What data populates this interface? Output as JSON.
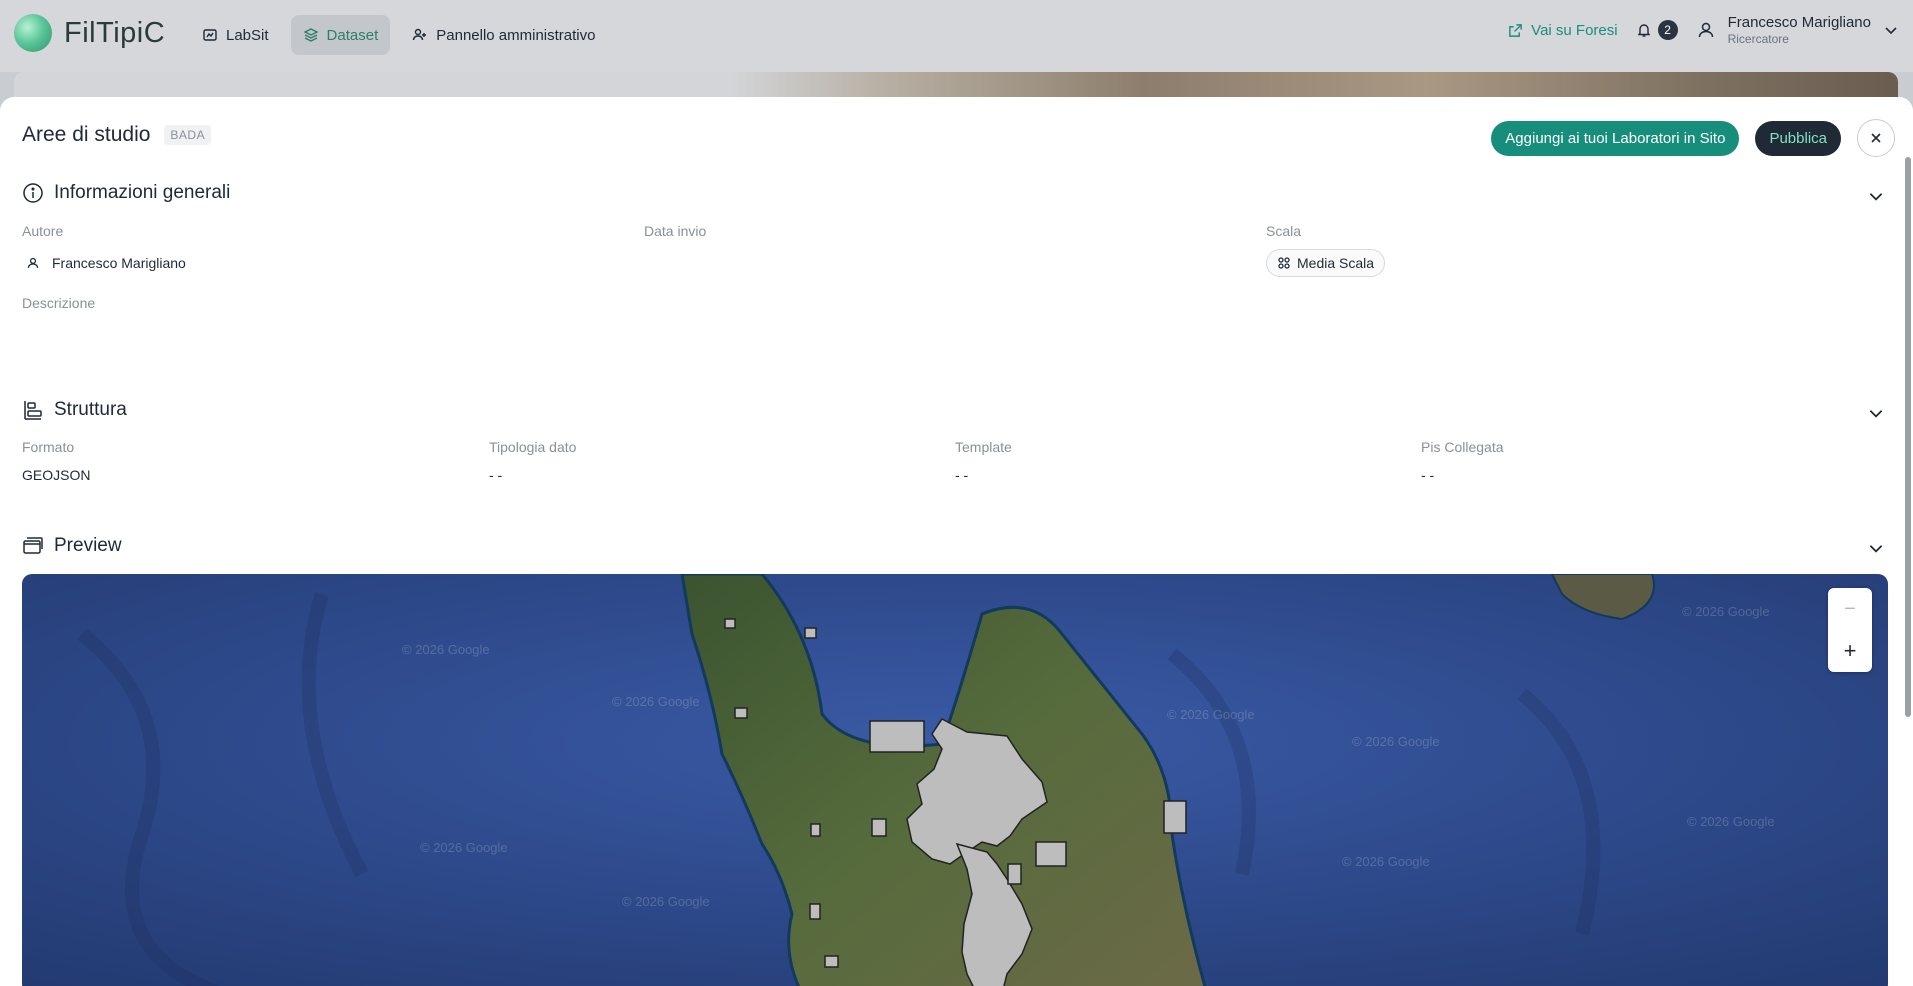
{
  "app": {
    "name": "FilTipiC"
  },
  "nav": {
    "items": [
      {
        "label": "LabSit",
        "icon": "lab-icon"
      },
      {
        "label": "Dataset",
        "icon": "layers-icon"
      },
      {
        "label": "Pannello amministrativo",
        "icon": "admin-users-icon"
      }
    ],
    "active_index": 1
  },
  "header_right": {
    "external_link": "Vai su Foresi",
    "notifications_count": "2",
    "user": {
      "name": "Francesco Marigliano",
      "role": "Ricercatore"
    }
  },
  "panel": {
    "title": "Aree di studio",
    "tag": "BADA",
    "add_button": "Aggiungi ai tuoi Laboratori in Sito",
    "publish_button": "Pubblica"
  },
  "general": {
    "title": "Informazioni generali",
    "author_label": "Autore",
    "author_value": "Francesco Marigliano",
    "date_label": "Data invio",
    "scale_label": "Scala",
    "scale_value": "Media Scala",
    "description_label": "Descrizione"
  },
  "structure": {
    "title": "Struttura",
    "fields": [
      {
        "label": "Formato",
        "value": "GEOJSON"
      },
      {
        "label": "Tipologia dato",
        "value": "- -"
      },
      {
        "label": "Template",
        "value": "- -"
      },
      {
        "label": "Pis Collegata",
        "value": "- -"
      }
    ]
  },
  "preview": {
    "title": "Preview",
    "watermark": "© 2026 Google",
    "zoom_out": "−",
    "zoom_in": "+"
  },
  "colors": {
    "accent_green": "#178e7c",
    "dark_button": "#1f2a36",
    "sea": "#2d4a8c",
    "land": "#3f5a34",
    "polygon_fill": "#bdbdbd"
  }
}
